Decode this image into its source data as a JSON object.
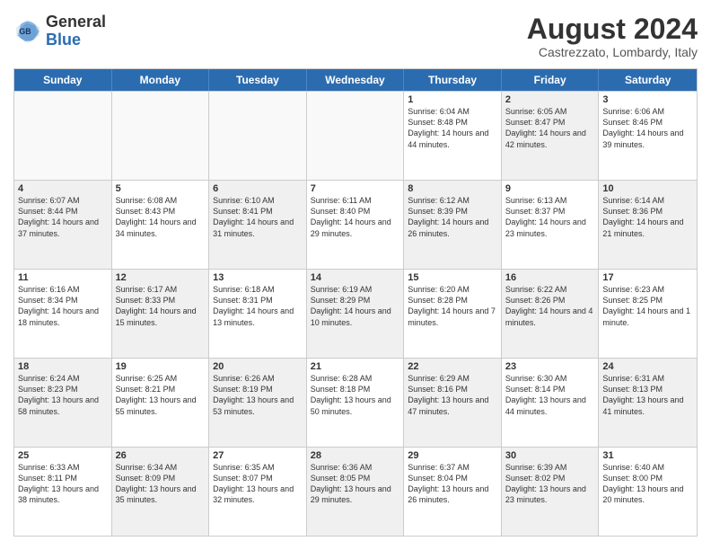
{
  "logo": {
    "line1": "General",
    "line2": "Blue"
  },
  "title": "August 2024",
  "subtitle": "Castrezzato, Lombardy, Italy",
  "days": [
    "Sunday",
    "Monday",
    "Tuesday",
    "Wednesday",
    "Thursday",
    "Friday",
    "Saturday"
  ],
  "weeks": [
    [
      {
        "day": "",
        "text": "",
        "empty": true
      },
      {
        "day": "",
        "text": "",
        "empty": true
      },
      {
        "day": "",
        "text": "",
        "empty": true
      },
      {
        "day": "",
        "text": "",
        "empty": true
      },
      {
        "day": "1",
        "text": "Sunrise: 6:04 AM\nSunset: 8:48 PM\nDaylight: 14 hours and 44 minutes.",
        "shaded": false
      },
      {
        "day": "2",
        "text": "Sunrise: 6:05 AM\nSunset: 8:47 PM\nDaylight: 14 hours and 42 minutes.",
        "shaded": true
      },
      {
        "day": "3",
        "text": "Sunrise: 6:06 AM\nSunset: 8:46 PM\nDaylight: 14 hours and 39 minutes.",
        "shaded": false
      }
    ],
    [
      {
        "day": "4",
        "text": "Sunrise: 6:07 AM\nSunset: 8:44 PM\nDaylight: 14 hours and 37 minutes.",
        "shaded": true
      },
      {
        "day": "5",
        "text": "Sunrise: 6:08 AM\nSunset: 8:43 PM\nDaylight: 14 hours and 34 minutes.",
        "shaded": false
      },
      {
        "day": "6",
        "text": "Sunrise: 6:10 AM\nSunset: 8:41 PM\nDaylight: 14 hours and 31 minutes.",
        "shaded": true
      },
      {
        "day": "7",
        "text": "Sunrise: 6:11 AM\nSunset: 8:40 PM\nDaylight: 14 hours and 29 minutes.",
        "shaded": false
      },
      {
        "day": "8",
        "text": "Sunrise: 6:12 AM\nSunset: 8:39 PM\nDaylight: 14 hours and 26 minutes.",
        "shaded": true
      },
      {
        "day": "9",
        "text": "Sunrise: 6:13 AM\nSunset: 8:37 PM\nDaylight: 14 hours and 23 minutes.",
        "shaded": false
      },
      {
        "day": "10",
        "text": "Sunrise: 6:14 AM\nSunset: 8:36 PM\nDaylight: 14 hours and 21 minutes.",
        "shaded": true
      }
    ],
    [
      {
        "day": "11",
        "text": "Sunrise: 6:16 AM\nSunset: 8:34 PM\nDaylight: 14 hours and 18 minutes.",
        "shaded": false
      },
      {
        "day": "12",
        "text": "Sunrise: 6:17 AM\nSunset: 8:33 PM\nDaylight: 14 hours and 15 minutes.",
        "shaded": true
      },
      {
        "day": "13",
        "text": "Sunrise: 6:18 AM\nSunset: 8:31 PM\nDaylight: 14 hours and 13 minutes.",
        "shaded": false
      },
      {
        "day": "14",
        "text": "Sunrise: 6:19 AM\nSunset: 8:29 PM\nDaylight: 14 hours and 10 minutes.",
        "shaded": true
      },
      {
        "day": "15",
        "text": "Sunrise: 6:20 AM\nSunset: 8:28 PM\nDaylight: 14 hours and 7 minutes.",
        "shaded": false
      },
      {
        "day": "16",
        "text": "Sunrise: 6:22 AM\nSunset: 8:26 PM\nDaylight: 14 hours and 4 minutes.",
        "shaded": true
      },
      {
        "day": "17",
        "text": "Sunrise: 6:23 AM\nSunset: 8:25 PM\nDaylight: 14 hours and 1 minute.",
        "shaded": false
      }
    ],
    [
      {
        "day": "18",
        "text": "Sunrise: 6:24 AM\nSunset: 8:23 PM\nDaylight: 13 hours and 58 minutes.",
        "shaded": true
      },
      {
        "day": "19",
        "text": "Sunrise: 6:25 AM\nSunset: 8:21 PM\nDaylight: 13 hours and 55 minutes.",
        "shaded": false
      },
      {
        "day": "20",
        "text": "Sunrise: 6:26 AM\nSunset: 8:19 PM\nDaylight: 13 hours and 53 minutes.",
        "shaded": true
      },
      {
        "day": "21",
        "text": "Sunrise: 6:28 AM\nSunset: 8:18 PM\nDaylight: 13 hours and 50 minutes.",
        "shaded": false
      },
      {
        "day": "22",
        "text": "Sunrise: 6:29 AM\nSunset: 8:16 PM\nDaylight: 13 hours and 47 minutes.",
        "shaded": true
      },
      {
        "day": "23",
        "text": "Sunrise: 6:30 AM\nSunset: 8:14 PM\nDaylight: 13 hours and 44 minutes.",
        "shaded": false
      },
      {
        "day": "24",
        "text": "Sunrise: 6:31 AM\nSunset: 8:13 PM\nDaylight: 13 hours and 41 minutes.",
        "shaded": true
      }
    ],
    [
      {
        "day": "25",
        "text": "Sunrise: 6:33 AM\nSunset: 8:11 PM\nDaylight: 13 hours and 38 minutes.",
        "shaded": false
      },
      {
        "day": "26",
        "text": "Sunrise: 6:34 AM\nSunset: 8:09 PM\nDaylight: 13 hours and 35 minutes.",
        "shaded": true
      },
      {
        "day": "27",
        "text": "Sunrise: 6:35 AM\nSunset: 8:07 PM\nDaylight: 13 hours and 32 minutes.",
        "shaded": false
      },
      {
        "day": "28",
        "text": "Sunrise: 6:36 AM\nSunset: 8:05 PM\nDaylight: 13 hours and 29 minutes.",
        "shaded": true
      },
      {
        "day": "29",
        "text": "Sunrise: 6:37 AM\nSunset: 8:04 PM\nDaylight: 13 hours and 26 minutes.",
        "shaded": false
      },
      {
        "day": "30",
        "text": "Sunrise: 6:39 AM\nSunset: 8:02 PM\nDaylight: 13 hours and 23 minutes.",
        "shaded": true
      },
      {
        "day": "31",
        "text": "Sunrise: 6:40 AM\nSunset: 8:00 PM\nDaylight: 13 hours and 20 minutes.",
        "shaded": false
      }
    ]
  ]
}
